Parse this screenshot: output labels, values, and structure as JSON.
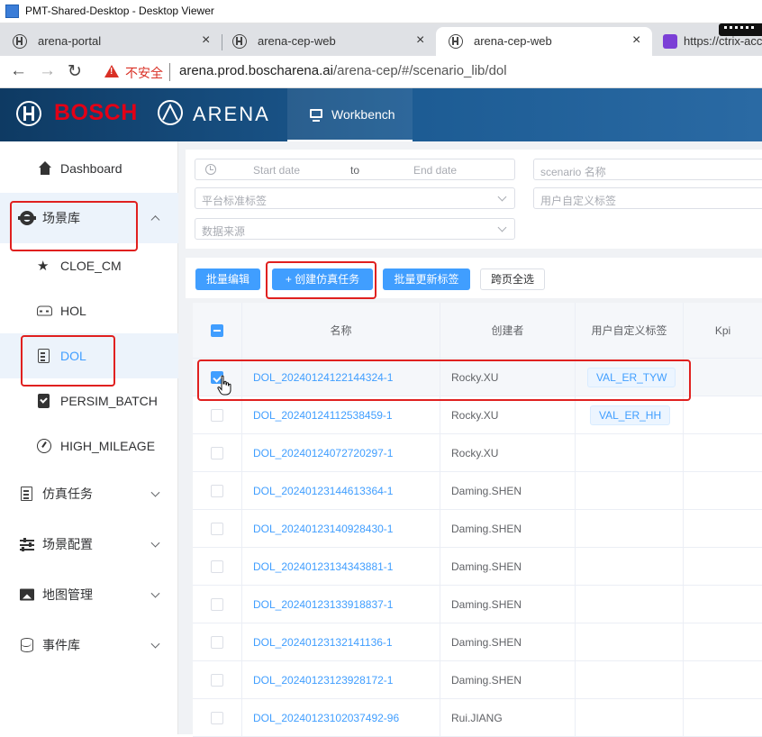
{
  "window": {
    "title": "PMT-Shared-Desktop - Desktop Viewer"
  },
  "browser": {
    "tabs": [
      {
        "label": "arena-portal",
        "close": "×"
      },
      {
        "label": "arena-cep-web",
        "close": "×"
      },
      {
        "label": "arena-cep-web",
        "close": "×"
      },
      {
        "label": "https://ctrix-acc"
      }
    ],
    "nav": {
      "back": "←",
      "forward": "→",
      "reload": "↻"
    },
    "security_label": "不安全",
    "url_host": "arena.prod.boscharena.ai",
    "url_path": "/arena-cep/#/scenario_lib/dol"
  },
  "header": {
    "brand": "BOSCH",
    "product": "ARENA",
    "nav_tab": "Workbench"
  },
  "sidebar": {
    "items": [
      {
        "label": "Dashboard",
        "icon": "home-icon"
      },
      {
        "label": "场景库",
        "icon": "gear-icon",
        "expanded": true
      },
      {
        "label": "CLOE_CM",
        "icon": "star-icon"
      },
      {
        "label": "HOL",
        "icon": "car-icon"
      },
      {
        "label": "DOL",
        "icon": "clipboard-icon",
        "active": true
      },
      {
        "label": "PERSIM_BATCH",
        "icon": "clipboard-check-icon"
      },
      {
        "label": "HIGH_MILEAGE",
        "icon": "gauge-icon"
      },
      {
        "label": "仿真任务",
        "icon": "document-icon"
      },
      {
        "label": "场景配置",
        "icon": "sliders-icon"
      },
      {
        "label": "地图管理",
        "icon": "image-icon"
      },
      {
        "label": "事件库",
        "icon": "database-icon"
      }
    ]
  },
  "filters": {
    "start_date_placeholder": "Start date",
    "date_separator": "to",
    "end_date_placeholder": "End date",
    "scenario_name_placeholder": "scenario 名称",
    "platform_tag_placeholder": "平台标准标签",
    "user_tag_placeholder": "用户自定义标签",
    "data_source_placeholder": "数据来源"
  },
  "actions": {
    "batch_edit": "批量编辑",
    "create_task_icon": "+",
    "create_task": "创建仿真任务",
    "batch_update_tags": "批量更新标签",
    "cross_page_select": "跨页全选"
  },
  "table": {
    "columns": [
      "名称",
      "创建者",
      "用户自定义标签",
      "Kpi"
    ],
    "header_checkbox": "indeterminate",
    "rows": [
      {
        "name": "DOL_20240124122144324-1",
        "creator": "Rocky.XU",
        "tag": "VAL_ER_TYW",
        "checked": true
      },
      {
        "name": "DOL_20240124112538459-1",
        "creator": "Rocky.XU",
        "tag": "VAL_ER_HH",
        "checked": false
      },
      {
        "name": "DOL_20240124072720297-1",
        "creator": "Rocky.XU",
        "tag": "",
        "checked": false
      },
      {
        "name": "DOL_20240123144613364-1",
        "creator": "Daming.SHEN",
        "tag": "",
        "checked": false
      },
      {
        "name": "DOL_20240123140928430-1",
        "creator": "Daming.SHEN",
        "tag": "",
        "checked": false
      },
      {
        "name": "DOL_20240123134343881-1",
        "creator": "Daming.SHEN",
        "tag": "",
        "checked": false
      },
      {
        "name": "DOL_20240123133918837-1",
        "creator": "Daming.SHEN",
        "tag": "",
        "checked": false
      },
      {
        "name": "DOL_20240123132141136-1",
        "creator": "Daming.SHEN",
        "tag": "",
        "checked": false
      },
      {
        "name": "DOL_20240123123928172-1",
        "creator": "Daming.SHEN",
        "tag": "",
        "checked": false
      },
      {
        "name": "DOL_20240123102037492-96",
        "creator": "Rui.JIANG",
        "tag": "",
        "checked": false
      }
    ]
  },
  "colors": {
    "primary": "#409eff",
    "highlight_box": "#e0201f",
    "bosch_red": "#e30016",
    "header_blue": "#1d5c94"
  }
}
